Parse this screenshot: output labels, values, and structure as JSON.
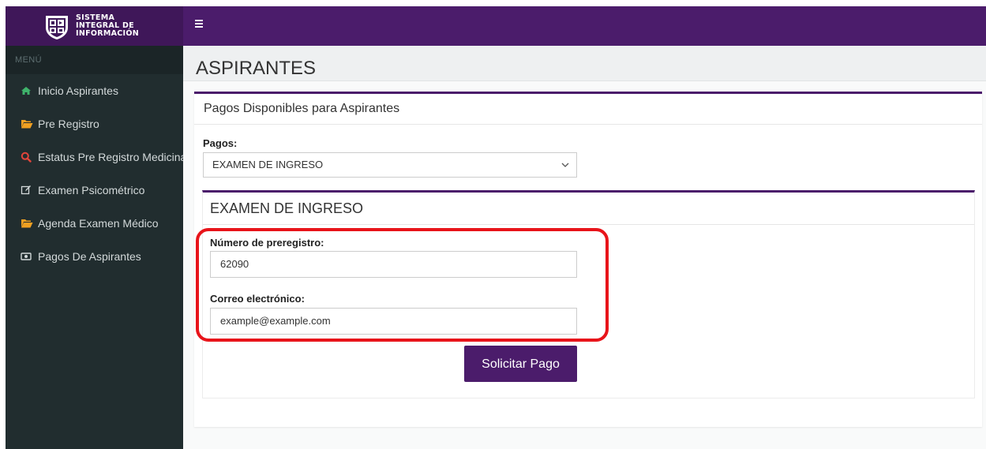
{
  "brand": {
    "line1": "SISTEMA",
    "line2": "INTEGRAL DE",
    "line3": "INFORMACIÓN",
    "logo_icon": "university-shield-icon"
  },
  "topbar": {
    "menu_toggle_icon": "hamburger-menu-icon"
  },
  "sidebar": {
    "header": "MENÚ",
    "items": [
      {
        "label": "Inicio Aspirantes",
        "icon": "home-icon",
        "icon_color": "#3fb36b"
      },
      {
        "label": "Pre Registro",
        "icon": "folder-open-icon",
        "icon_color": "#f0a022"
      },
      {
        "label": "Estatus Pre Registro Medicina",
        "icon": "search-icon",
        "icon_color": "#e2453b"
      },
      {
        "label": "Examen Psicométrico",
        "icon": "edit-icon",
        "icon_color": "#d3d9da"
      },
      {
        "label": "Agenda Examen Médico",
        "icon": "folder-open-icon",
        "icon_color": "#f0a022"
      },
      {
        "label": "Pagos De Aspirantes",
        "icon": "money-icon",
        "icon_color": "#d3d9da"
      }
    ]
  },
  "main": {
    "page_title": "ASPIRANTES",
    "panel_title": "Pagos Disponibles para Aspirantes",
    "pagos_label": "Pagos:",
    "pagos_selected": "EXAMEN DE INGRESO",
    "form": {
      "title": "EXAMEN DE INGRESO",
      "preregistro_label": "Número de preregistro:",
      "preregistro_value": "62090",
      "correo_label": "Correo electrónico:",
      "correo_value": "example@example.com",
      "submit_label": "Solicitar Pago"
    }
  },
  "colors": {
    "brand_purple": "#4b1c6b",
    "sidebar_bg": "#212d2f",
    "highlight_red": "#e8141a"
  }
}
